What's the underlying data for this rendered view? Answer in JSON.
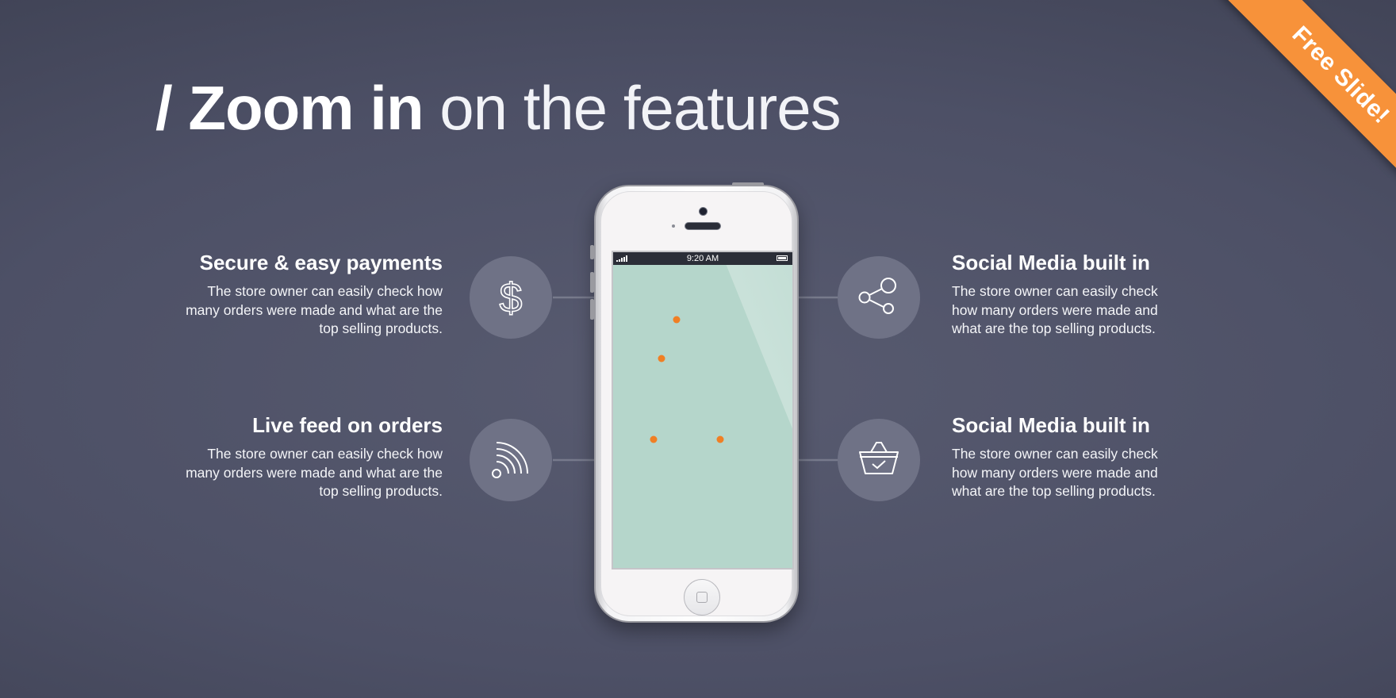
{
  "title": {
    "slash_bold": "/ Zoom in",
    "light": " on the features"
  },
  "ribbon": {
    "label": "Free Slide!",
    "color": "#f7923a"
  },
  "phone": {
    "status_time": "9:20 AM",
    "screen_color": "#b5d6cb"
  },
  "features": [
    {
      "title": "Secure & easy payments",
      "description": "The store owner can easily check how many orders were made and what are the top selling products.",
      "icon": "dollar-icon"
    },
    {
      "title": "Live feed on orders",
      "description": "The store owner can easily check how many orders were made and what are the top selling products.",
      "icon": "rss-feed-icon"
    },
    {
      "title": "Social Media built in",
      "description": "The store owner can easily check how many orders were made and what are the top selling products.",
      "icon": "share-icon"
    },
    {
      "title": "Social Media built in",
      "description": "The store owner can easily check how many orders were made and what are the top selling products.",
      "icon": "basket-check-icon"
    }
  ],
  "colors": {
    "accent_dot": "#f07f24",
    "icon_circle": "#6f7286",
    "connector_line": "#777a8c"
  }
}
